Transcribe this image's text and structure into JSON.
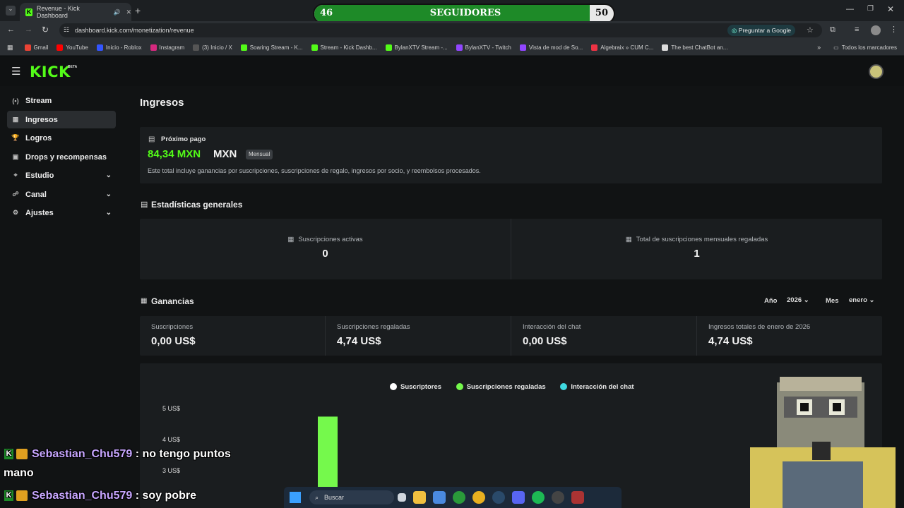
{
  "browser": {
    "tab_title": "Revenue - Kick Dashboard",
    "url": "dashboard.kick.com/monetization/revenue",
    "ask_google": "Preguntar a Google",
    "bookmarks": [
      "Gmail",
      "YouTube",
      "Inicio - Roblox",
      "Instagram",
      "(3) Inicio / X",
      "Soaring Stream - K...",
      "Stream - Kick Dashb...",
      "BylanXTV Stream -...",
      "BylanXTV - Twitch",
      "Vista de mod de So...",
      "Algebraix » CUM C...",
      "The best ChatBot an..."
    ],
    "all_bookmarks": "Todos los marcadores",
    "colors": {
      "tab": "#2b2f33",
      "bar": "#1c1f22"
    }
  },
  "goal": {
    "current": "46",
    "label": "SEGUIDORES",
    "target": "50",
    "progress": 0.92
  },
  "app": {
    "logo": "KICK",
    "logo_badge": "BETA",
    "accent": "#53fc18"
  },
  "sidebar": {
    "items": [
      {
        "label": "Stream",
        "icon": "broadcast-icon",
        "glyph": "(•)"
      },
      {
        "label": "Ingresos",
        "icon": "revenue-icon",
        "glyph": "▦",
        "active": true
      },
      {
        "label": "Logros",
        "icon": "trophy-icon",
        "glyph": "🏆"
      },
      {
        "label": "Drops y recompensas",
        "icon": "gift-icon",
        "glyph": "▣"
      },
      {
        "label": "Estudio",
        "icon": "studio-icon",
        "glyph": "⌖",
        "chevron": true
      },
      {
        "label": "Canal",
        "icon": "channel-icon",
        "glyph": "☍",
        "chevron": true
      },
      {
        "label": "Ajustes",
        "icon": "settings-icon",
        "glyph": "⚙",
        "chevron": true
      }
    ]
  },
  "main": {
    "title": "Ingresos",
    "next_payment": {
      "label": "Próximo pago",
      "amount": "84,34 MXN",
      "currency": "MXN",
      "badge": "Mensual",
      "note": "Este total incluye ganancias por suscripciones, suscripciones de regalo, ingresos por socio, y reembolsos procesados."
    },
    "general_stats": {
      "title": "Estadísticas generales",
      "items": [
        {
          "label": "Suscripciones activas",
          "value": "0"
        },
        {
          "label": "Total de suscripciones mensuales regaladas",
          "value": "1"
        }
      ]
    },
    "earnings": {
      "title": "Ganancias",
      "year_label": "Año",
      "year": "2026",
      "month_label": "Mes",
      "month": "enero",
      "items": [
        {
          "label": "Suscripciones",
          "value": "0,00 US$"
        },
        {
          "label": "Suscripciones regaladas",
          "value": "4,74 US$"
        },
        {
          "label": "Interacción del chat",
          "value": "0,00 US$"
        },
        {
          "label": "Ingresos totales de enero de 2026",
          "value": "4,74 US$"
        }
      ]
    },
    "chart": {
      "legend": [
        {
          "name": "Suscriptores",
          "color": "#ffffff"
        },
        {
          "name": "Suscripciones regaladas",
          "color": "#75f94c"
        },
        {
          "name": "Interacción del chat",
          "color": "#3fd9e0"
        }
      ],
      "y_ticks": [
        "5 US$",
        "4 US$",
        "3 US$"
      ]
    }
  },
  "chart_data": {
    "type": "bar",
    "series": [
      {
        "name": "Suscripciones regaladas",
        "values": [
          4.74
        ]
      }
    ],
    "ylim": [
      2.5,
      5
    ]
  },
  "chat": [
    {
      "user": "Sebastian_Chu579",
      "message": ": no tengo puntos"
    },
    {
      "continuation": "mano"
    },
    {
      "user": "Sebastian_Chu579",
      "message": ": soy pobre"
    }
  ],
  "taskbar": {
    "search": "Buscar"
  }
}
